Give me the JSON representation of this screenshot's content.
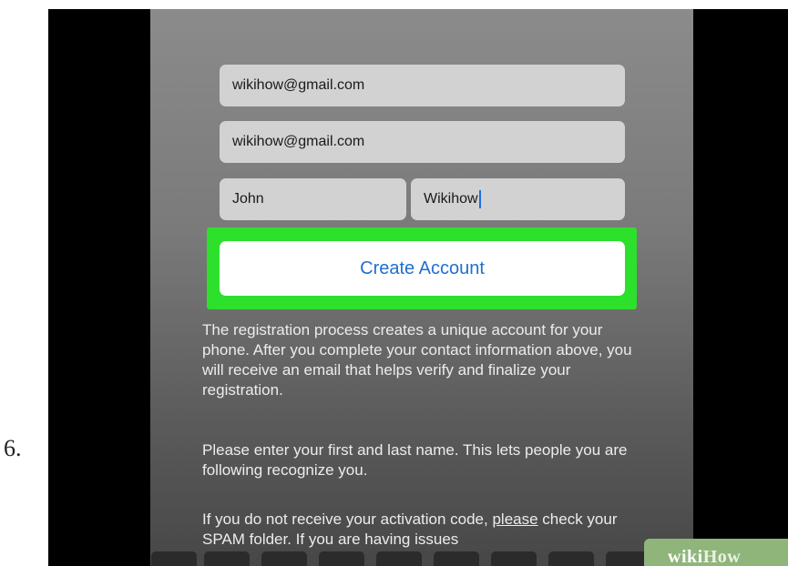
{
  "step": {
    "number": "6."
  },
  "form": {
    "email": "wikihow@gmail.com",
    "confirm_email": "wikihow@gmail.com",
    "first_name": "John",
    "last_name": "Wikihow",
    "create_button_label": "Create Account",
    "highlight_color": "#2ce02c",
    "button_text_color": "#1f6fcf"
  },
  "info": {
    "paragraph1": " The registration process creates a unique account for your phone. After you complete your contact information above, you will receive an email that helps verify and finalize your registration.",
    "paragraph2": "Please enter your first and last name. This lets people you are following recognize you.",
    "paragraph3_prefix": "If you do not receive your activation code, ",
    "paragraph3_link": "please",
    "paragraph3_suffix": " check your SPAM folder. If you are having issues"
  },
  "watermark": {
    "part1": "wiki",
    "part2": "How"
  }
}
